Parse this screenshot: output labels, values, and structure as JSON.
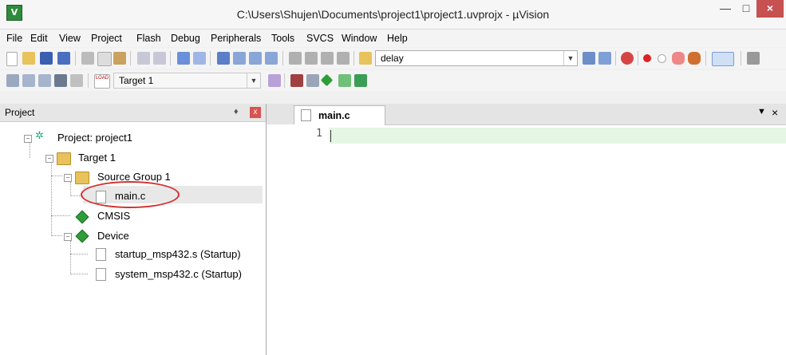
{
  "window": {
    "title": "C:\\Users\\Shujen\\Documents\\project1\\project1.uvprojx - µVision",
    "icon_text": "V",
    "minimize": "—",
    "maximize": "□",
    "close": "×"
  },
  "menu": [
    "File",
    "Edit",
    "View",
    "Project",
    "Flash",
    "Debug",
    "Peripherals",
    "Tools",
    "SVCS",
    "Window",
    "Help"
  ],
  "toolbar": {
    "find_value": "delay",
    "target_value": "Target 1",
    "load_label": "LOAD"
  },
  "project_panel": {
    "title": "Project",
    "pin": "♦",
    "close": "x",
    "tree": {
      "root": "Project: project1",
      "target": "Target 1",
      "source_group": "Source Group 1",
      "file_main": "main.c",
      "cmsis": "CMSIS",
      "device": "Device",
      "startup": "startup_msp432.s (Startup)",
      "system": "system_msp432.c (Startup)"
    }
  },
  "editor": {
    "tab_label": "main.c",
    "tab_menu": "▼",
    "tab_close": "×",
    "line_number": "1"
  },
  "colors": {
    "close_button": "#c75050",
    "current_line": "#e4f6e4",
    "annotation": "#d62e2e"
  }
}
